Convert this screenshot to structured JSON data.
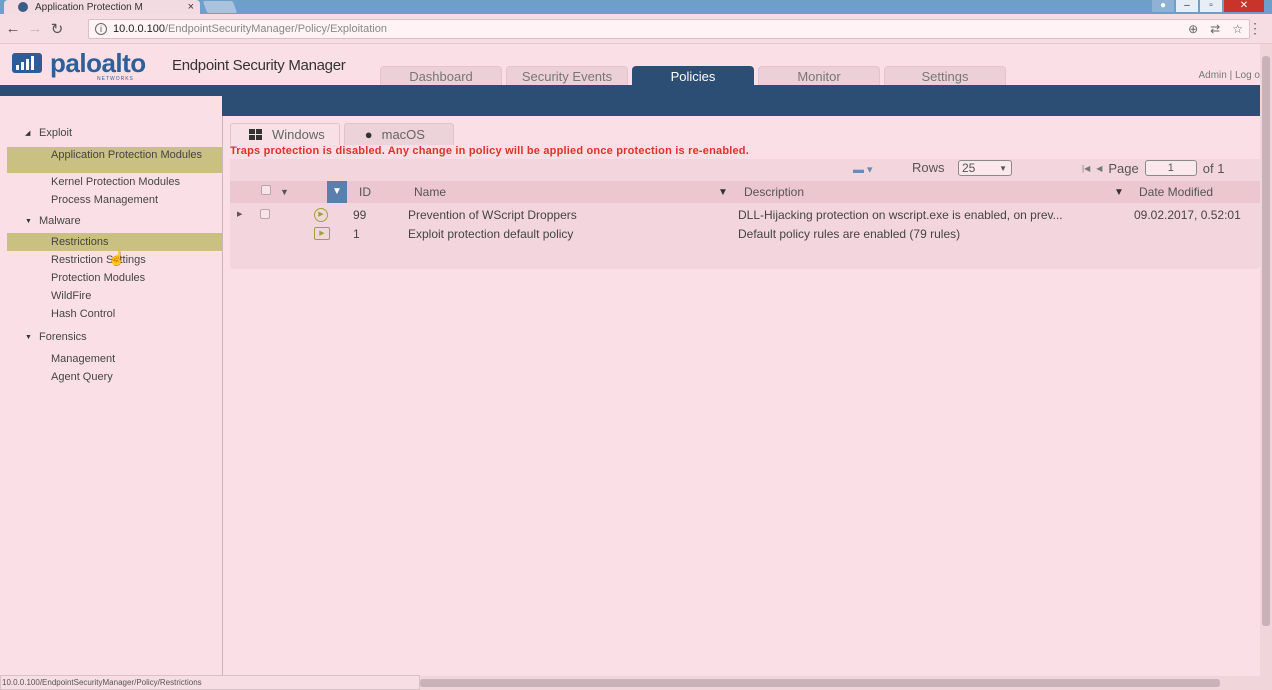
{
  "browser": {
    "tab_title": "Application Protection M",
    "tab_close": "×",
    "url_host": "10.0.0.100",
    "url_path": "/EndpointSecurityManager/Policy/Exploitation",
    "status_url": "10.0.0.100/EndpointSecurityManager/Policy/Restrictions"
  },
  "header": {
    "logo_palo": "palo",
    "logo_alto": "alto",
    "logo_sub": "NETWORKS",
    "product": "Endpoint Security Manager",
    "tabs": [
      "Dashboard",
      "Security Events",
      "Policies",
      "Monitor",
      "Settings"
    ],
    "active_tab": "Policies",
    "admin_links": "Admin | Log o"
  },
  "sidebar": {
    "groups": [
      {
        "label": "Exploit",
        "items": [
          "Application Protection Modules",
          "Kernel Protection Modules",
          "Process Management"
        ]
      },
      {
        "label": "Malware",
        "items": [
          "Restrictions",
          "Restriction Settings",
          "Protection Modules",
          "WildFire",
          "Hash Control"
        ]
      },
      {
        "label": "Forensics",
        "items": [
          "Management",
          "Agent Query"
        ]
      }
    ],
    "active_item": "Restrictions"
  },
  "content": {
    "os_tabs": [
      "Windows",
      "macOS"
    ],
    "warning": "Traps protection is disabled. Any change in policy will be applied once protection is re-enabled.",
    "rows_label": "Rows",
    "rows_value": "25",
    "page_label": "Page",
    "page_value": "1",
    "page_total": "of 1",
    "columns": {
      "id": "ID",
      "name": "Name",
      "description": "Description",
      "date": "Date Modified"
    },
    "rows": [
      {
        "id": "99",
        "name": "Prevention of WScript Droppers",
        "description": "DLL-Hijacking protection on wscript.exe is enabled, on prev...",
        "date": "09.02.2017, 0.52:01"
      },
      {
        "id": "1",
        "name": "Exploit protection default policy",
        "description": "Default policy rules are enabled (79 rules)",
        "date": ""
      }
    ]
  },
  "icons": {
    "favicon": "shield-icon",
    "windows": "windows-logo-icon",
    "macos": "apple-logo-icon",
    "filter": "filter-icon",
    "policy_active": "play-circle-icon",
    "policy_default": "play-square-icon"
  },
  "colors": {
    "nav_dark": "#2d4e74",
    "warning": "#e0322b",
    "active_sidebar": "#c9c081",
    "policy_icon": "#9aa43a"
  }
}
